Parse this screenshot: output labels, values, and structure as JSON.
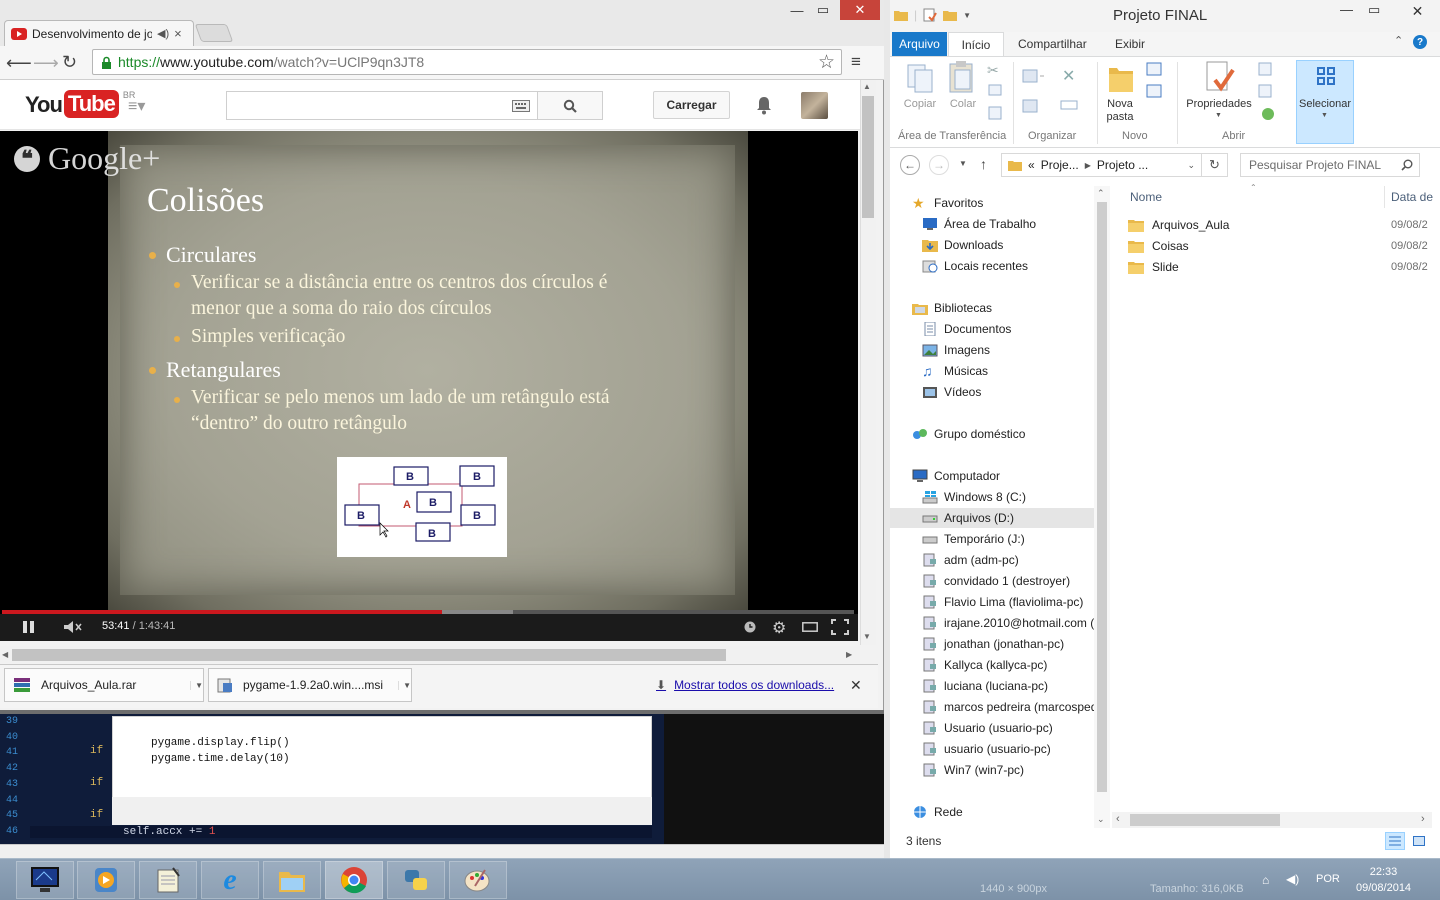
{
  "chrome": {
    "tab_title": "Desenvolvimento de jo",
    "url_scheme": "https://",
    "url_host": "www.youtube.com",
    "url_path": "/watch?v=UClP9qn3JT8"
  },
  "youtube": {
    "logo_you": "You",
    "logo_tube": "Tube",
    "logo_region": "BR",
    "search_placeholder": "",
    "upload_label": "Carregar"
  },
  "video": {
    "watermark": "Google+",
    "slide_title": "Colisões",
    "bullets": [
      {
        "text": "Circulares",
        "sub": [
          "Verificar se a distância entre os centros dos círculos é",
          "menor que a soma do raio dos círculos",
          "Simples verificação"
        ]
      },
      {
        "text": "Retangulares",
        "sub": [
          "Verificar se pelo menos um lado de um retângulo está",
          "“dentro” do outro retângulo"
        ]
      }
    ],
    "diagram_label_a": "A",
    "diagram_label_b": "B",
    "current_time": "53:41",
    "duration": "/ 1:43:41",
    "progress_fraction": 0.517,
    "buffered_fraction": 0.6
  },
  "downloads": {
    "items": [
      {
        "name": "Arquivos_Aula.rar"
      },
      {
        "name": "pygame-1.9.2a0.win....msi"
      }
    ],
    "show_all": "Mostrar todos os downloads..."
  },
  "editor": {
    "line_numbers": [
      "39",
      "40",
      "41",
      "42",
      "43",
      "44",
      "45",
      "46"
    ],
    "popup_lines": [
      "pygame.display.flip()",
      "pygame.time.delay(10)"
    ],
    "if_fragment": "if",
    "current_line_code": "self.accx += ",
    "current_line_number": "1"
  },
  "explorer": {
    "title": "Projeto FINAL",
    "tabs": [
      "Arquivo",
      "Início",
      "Compartilhar",
      "Exibir"
    ],
    "ribbon": {
      "copy": "Copiar",
      "paste": "Colar",
      "new_folder": [
        "Nova",
        "pasta"
      ],
      "properties": "Propriedades",
      "select": "Selecionar",
      "groups": [
        "Área de Transferência",
        "Organizar",
        "Novo",
        "Abrir"
      ]
    },
    "address": {
      "prefix": "«",
      "crumb1": "Proje...",
      "crumb2": "Projeto ..."
    },
    "search_placeholder": "Pesquisar Projeto FINAL",
    "nav": {
      "favorites": "Favoritos",
      "fav_items": [
        "Área de Trabalho",
        "Downloads",
        "Locais recentes"
      ],
      "libraries": "Bibliotecas",
      "lib_items": [
        "Documentos",
        "Imagens",
        "Músicas",
        "Vídeos"
      ],
      "homegroup": "Grupo doméstico",
      "computer": "Computador",
      "computer_items": [
        "Windows 8 (C:)",
        "Arquivos (D:)",
        "Temporário (J:)",
        "adm (adm-pc)",
        "convidado 1 (destroyer)",
        "Flavio Lima (flaviolima-pc)",
        "irajane.2010@hotmail.com (i",
        "jonathan (jonathan-pc)",
        "Kallyca (kallyca-pc)",
        "luciana (luciana-pc)",
        "marcos pedreira (marcosped",
        "Usuario (usuario-pc)",
        "usuario (usuario-pc)",
        "Win7 (win7-pc)"
      ],
      "network": "Rede"
    },
    "columns": {
      "name": "Nome",
      "date": "Data de"
    },
    "files": [
      {
        "name": "Arquivos_Aula",
        "date": "09/08/2"
      },
      {
        "name": "Coisas",
        "date": "09/08/2"
      },
      {
        "name": "Slide",
        "date": "09/08/2"
      }
    ],
    "status": "3 itens"
  },
  "taskbar": {
    "lang": "POR",
    "time": "22:33",
    "date": "09/08/2014",
    "ghost_size": "1440 × 900px",
    "ghost_filesize": "Tamanho: 316,0KB"
  },
  "colors": {
    "youtube_red": "#cc181e",
    "ribbon_blue": "#1979ca",
    "selection_blue": "#cce8ff",
    "close_red": "#c7443a"
  }
}
